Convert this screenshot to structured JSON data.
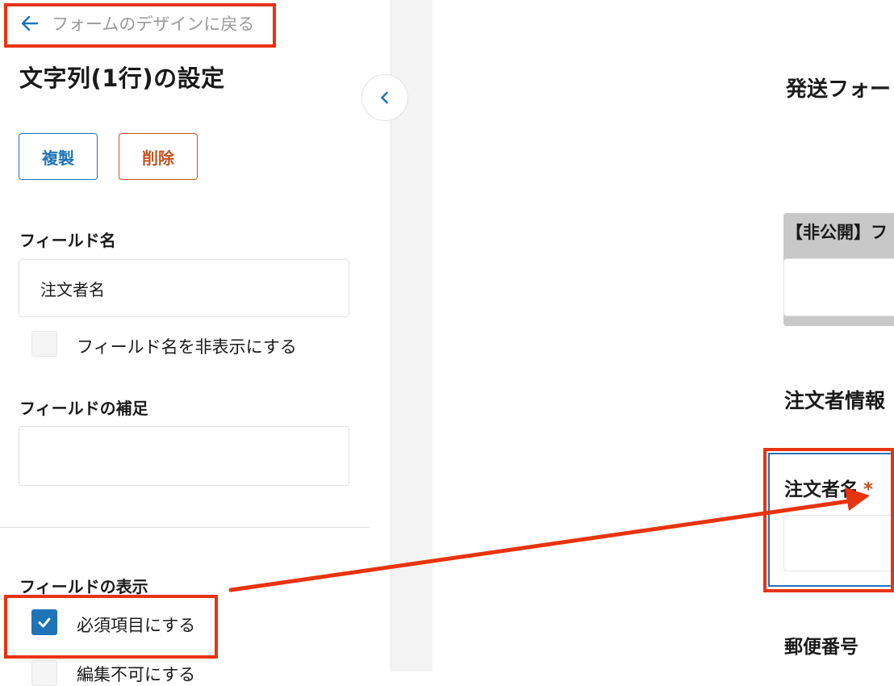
{
  "settings": {
    "back_label": "フォームのデザインに戻る",
    "title": "文字列(1行)の設定",
    "copy_button": "複製",
    "delete_button": "削除",
    "field_name_label": "フィールド名",
    "field_name_value": "注文者名",
    "hide_field_name_label": "フィールド名を非表示にする",
    "hide_field_name_checked": false,
    "field_note_label": "フィールドの補足",
    "field_note_value": "",
    "display_label": "フィールドの表示",
    "required_label": "必須項目にする",
    "required_checked": true,
    "readonly_label": "編集不可にする",
    "readonly_checked": false
  },
  "preview": {
    "form_title": "発送フォー",
    "private_section_title": "【非公開】フ",
    "orderer_section_title": "注文者情報",
    "orderer_name_label": "注文者名",
    "required_mark": "*",
    "postal_label": "郵便番号"
  },
  "colors": {
    "accent": "#1f73b7",
    "danger": "#c6521d",
    "annotation": "#e8330f"
  },
  "icons": {
    "back": "arrow-left-icon",
    "collapse": "chevron-left-icon",
    "check": "check-icon"
  }
}
